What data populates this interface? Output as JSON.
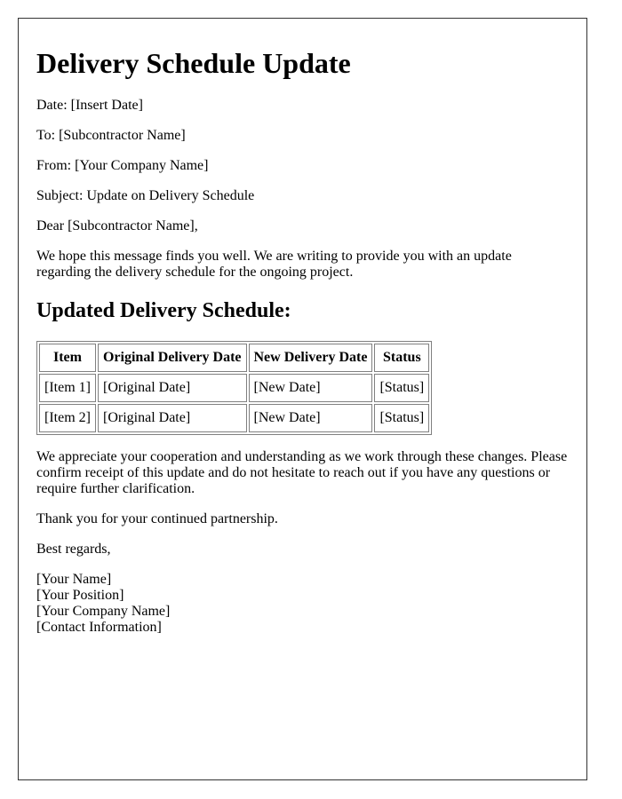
{
  "title": "Delivery Schedule Update",
  "fields": {
    "date": "Date: [Insert Date]",
    "to": "To: [Subcontractor Name]",
    "from": "From: [Your Company Name]",
    "subject": "Subject: Update on Delivery Schedule"
  },
  "salutation": "Dear [Subcontractor Name],",
  "intro": "We hope this message finds you well. We are writing to provide you with an update regarding the delivery schedule for the ongoing project.",
  "section_title": "Updated Delivery Schedule:",
  "table": {
    "headers": [
      "Item",
      "Original Delivery Date",
      "New Delivery Date",
      "Status"
    ],
    "rows": [
      [
        "[Item 1]",
        "[Original Date]",
        "[New Date]",
        "[Status]"
      ],
      [
        "[Item 2]",
        "[Original Date]",
        "[New Date]",
        "[Status]"
      ]
    ]
  },
  "closing_paragraph": "We appreciate your cooperation and understanding as we work through these changes. Please confirm receipt of this update and do not hesitate to reach out if you have any questions or require further clarification.",
  "thanks": "Thank you for your continued partnership.",
  "sign_off": "Best regards,",
  "signature": [
    "[Your Name]",
    "[Your Position]",
    "[Your Company Name]",
    "[Contact Information]"
  ]
}
